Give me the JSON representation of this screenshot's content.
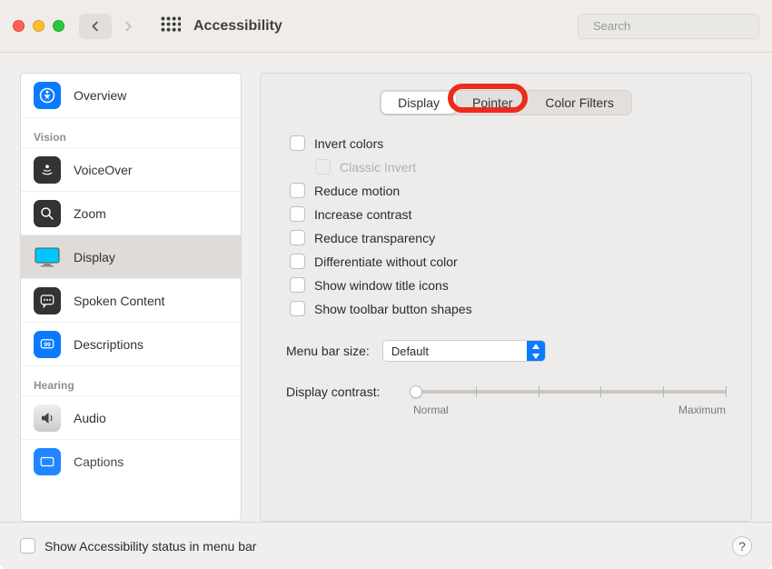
{
  "window": {
    "title": "Accessibility",
    "search_placeholder": "Search"
  },
  "sidebar": {
    "items": [
      {
        "label": "Overview"
      }
    ],
    "headings": {
      "vision": "Vision",
      "hearing": "Hearing"
    },
    "vision": [
      {
        "label": "VoiceOver"
      },
      {
        "label": "Zoom"
      },
      {
        "label": "Display",
        "selected": true
      },
      {
        "label": "Spoken Content"
      },
      {
        "label": "Descriptions"
      }
    ],
    "hearing": [
      {
        "label": "Audio"
      },
      {
        "label": "Captions"
      }
    ]
  },
  "tabs": {
    "display": "Display",
    "pointer": "Pointer",
    "colorfilters": "Color Filters",
    "active": "display"
  },
  "options": {
    "invert_colors": "Invert colors",
    "classic_invert": "Classic Invert",
    "reduce_motion": "Reduce motion",
    "increase_contrast": "Increase contrast",
    "reduce_transparency": "Reduce transparency",
    "differentiate": "Differentiate without color",
    "show_title_icons": "Show window title icons",
    "show_toolbar_shapes": "Show toolbar button shapes"
  },
  "menubar": {
    "label": "Menu bar size:",
    "value": "Default"
  },
  "contrast": {
    "label": "Display contrast:",
    "min_label": "Normal",
    "max_label": "Maximum",
    "value": 0
  },
  "footer": {
    "show_status": "Show Accessibility status in menu bar"
  }
}
